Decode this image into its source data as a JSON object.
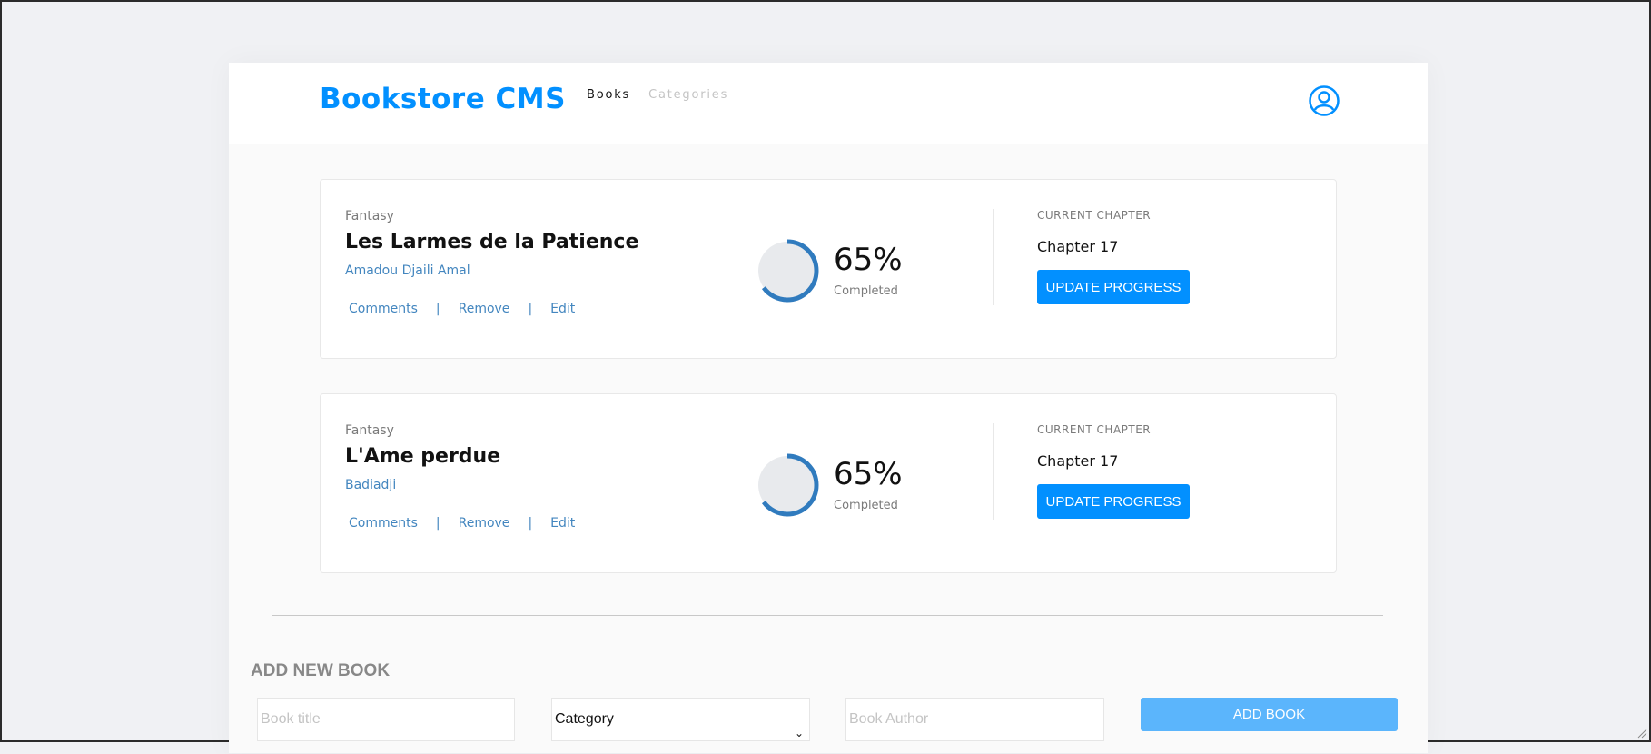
{
  "header": {
    "logo": "Bookstore CMS",
    "nav": [
      {
        "label": "Books",
        "active": true
      },
      {
        "label": "Categories",
        "active": false
      }
    ],
    "user_icon": "user-circle-icon"
  },
  "books": [
    {
      "genre": "Fantasy",
      "title": "Les Larmes de la Patience",
      "author": "Amadou Djaili Amal",
      "actions": [
        "Comments",
        "Remove",
        "Edit"
      ],
      "progress": 0.65,
      "percent_label": "65%",
      "completed_label": "Completed",
      "chapter_label": "CURRENT CHAPTER",
      "chapter": "Chapter 17",
      "update_label": "UPDATE PROGRESS"
    },
    {
      "genre": "Fantasy",
      "title": "L'Ame perdue",
      "author": "Badiadji",
      "actions": [
        "Comments",
        "Remove",
        "Edit"
      ],
      "progress": 0.65,
      "percent_label": "65%",
      "completed_label": "Completed",
      "chapter_label": "CURRENT CHAPTER",
      "chapter": "Chapter 17",
      "update_label": "UPDATE PROGRESS"
    }
  ],
  "form": {
    "heading": "ADD NEW BOOK",
    "title_placeholder": "Book title",
    "category_value": "Category",
    "author_placeholder": "Book Author",
    "submit_label": "ADD BOOK"
  },
  "colors": {
    "accent": "#0290ff",
    "link": "#4386bf",
    "submit": "#5bb5fc"
  }
}
